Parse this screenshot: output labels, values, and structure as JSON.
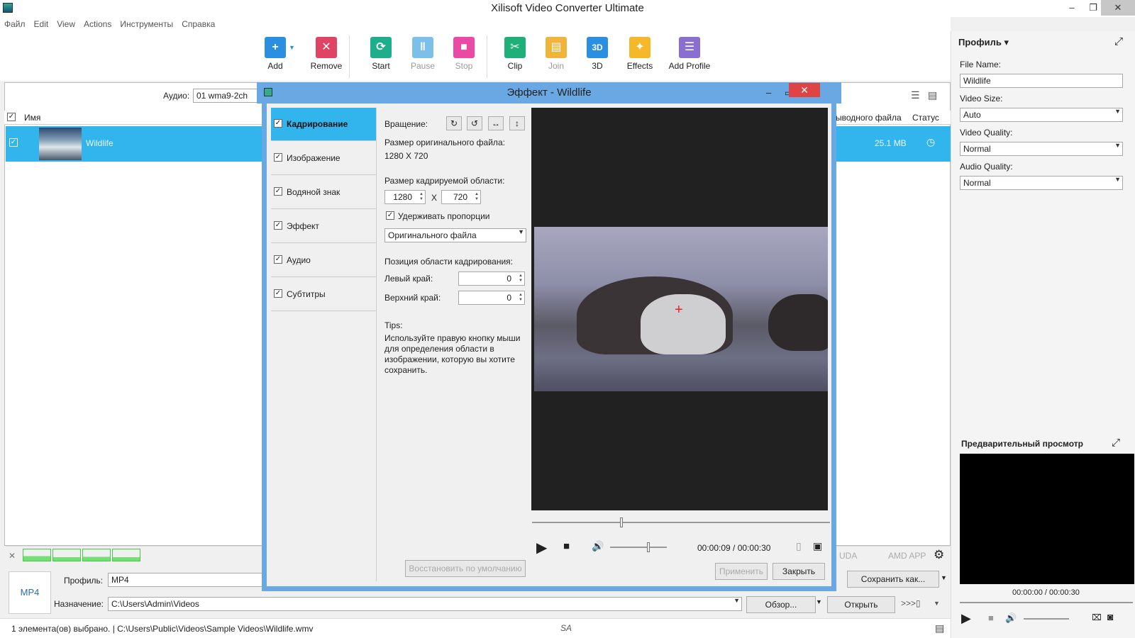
{
  "window": {
    "title": "Xilisoft Video Converter Ultimate",
    "min": "–",
    "max": "❐",
    "close": "✕"
  },
  "menu": [
    "Файл",
    "Edit",
    "View",
    "Actions",
    "Инструменты",
    "Справка"
  ],
  "toolbar": {
    "add": "Add",
    "remove": "Remove",
    "start": "Start",
    "pause": "Pause",
    "stop": "Stop",
    "clip": "Clip",
    "join": "Join",
    "three_d": "3D",
    "effects": "Effects",
    "add_profile": "Add Profile"
  },
  "audio_filter": {
    "label": "Аудио:",
    "value": "01 wma9-2ch"
  },
  "file_list": {
    "col_name": "Имя",
    "col_output": "ыводного файла",
    "col_status": "Статус",
    "rows": [
      {
        "name": "Wildlife",
        "size": "25.1 MB"
      }
    ]
  },
  "bottom": {
    "profile_label": "Профиль:",
    "profile_value": "MP4",
    "dest_label": "Назначение:",
    "dest_value": "C:\\Users\\Admin\\Videos",
    "browse": "Обзор...",
    "open": "Открыть",
    "save_as": "Сохранить как...",
    "cuda": "UDA",
    "amd": "AMD APP",
    "status": "1 элемента(ов) выбрано. | C:\\Users\\Public\\Videos\\Sample Videos\\Wildlife.wmv"
  },
  "side": {
    "profile_header": "Профиль",
    "file_name_label": "File Name:",
    "file_name": "Wildlife",
    "video_size_label": "Video Size:",
    "video_size": "Auto",
    "video_quality_label": "Video Quality:",
    "video_quality": "Normal",
    "audio_quality_label": "Audio Quality:",
    "audio_quality": "Normal",
    "preview_header": "Предварительный просмотр",
    "preview_time": "00:00:00 / 00:00:30"
  },
  "dialog": {
    "title": "Эффект - Wildlife",
    "tabs": [
      "Кадрирование",
      "Изображение",
      "Водяной знак",
      "Эффект",
      "Аудио",
      "Субтитры"
    ],
    "rotation_label": "Вращение:",
    "orig_size_label": "Размер оригинального файла:",
    "orig_size": "1280 X 720",
    "crop_size_label": "Размер кадрируемой области:",
    "crop_w": "1280",
    "crop_x": "X",
    "crop_h": "720",
    "keep_ratio": "Удерживать пропорции",
    "ratio_value": "Оригинального файла",
    "pos_label": "Позиция области кадрирования:",
    "left_label": "Левый край:",
    "left_value": "0",
    "top_label": "Верхний край:",
    "top_value": "0",
    "tips_label": "Tips:",
    "tips_text": "Используйте правую кнопку мыши для определения области в изображении, которую вы хотите сохранить.",
    "restore": "Восстановить по умолчанию",
    "time": "00:00:09 / 00:00:30",
    "apply": "Применить",
    "close": "Закрыть"
  },
  "colors": {
    "accent": "#32b4ec",
    "dialog_border": "#6aa8e4",
    "close_red": "#e04343"
  }
}
